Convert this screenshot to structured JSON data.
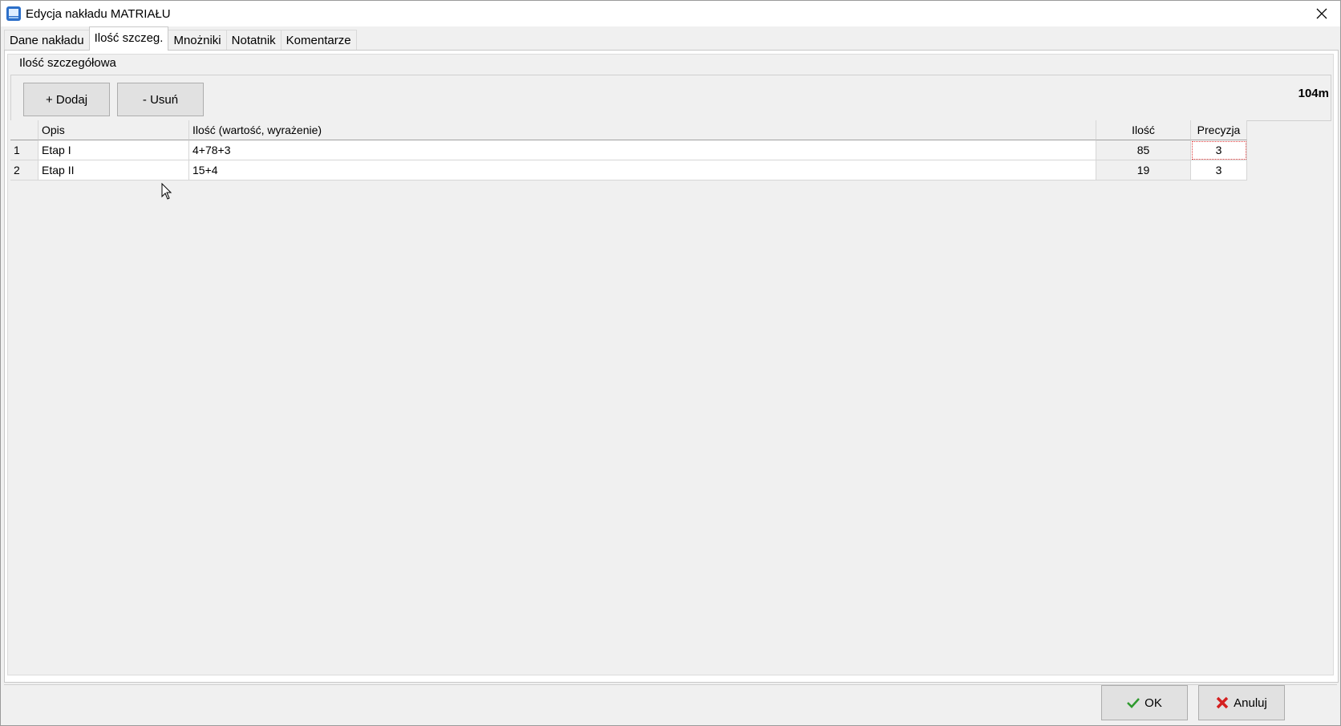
{
  "window": {
    "title": "Edycja nakładu MATRIAŁU",
    "close_icon": "close-icon",
    "app_icon": "app-icon"
  },
  "tabs": [
    {
      "label": "Dane nakładu",
      "active": false
    },
    {
      "label": "Ilość szczeg.",
      "active": true
    },
    {
      "label": "Mnożniki",
      "active": false
    },
    {
      "label": "Notatnik",
      "active": false
    },
    {
      "label": "Komentarze",
      "active": false
    }
  ],
  "group": {
    "title": "Ilość szczegółowa",
    "add_label": "+ Dodaj",
    "remove_label": "- Usuń",
    "total": "104m"
  },
  "table": {
    "headers": [
      "",
      "Opis",
      "Ilość (wartość, wyrażenie)",
      "Ilość",
      "Precyzja"
    ],
    "rows": [
      {
        "num": "1",
        "opis": "Etap I",
        "wyrazenie": "4+78+3",
        "ilosc": "85",
        "precyzja": "3"
      },
      {
        "num": "2",
        "opis": "Etap II",
        "wyrazenie": "15+4",
        "ilosc": "19",
        "precyzja": "3"
      }
    ]
  },
  "footer": {
    "ok_label": "OK",
    "cancel_label": "Anuluj",
    "ok_icon": "checkmark-icon",
    "cancel_icon": "x-icon",
    "ok_color": "#2e9a2e",
    "cancel_color": "#d42020"
  }
}
